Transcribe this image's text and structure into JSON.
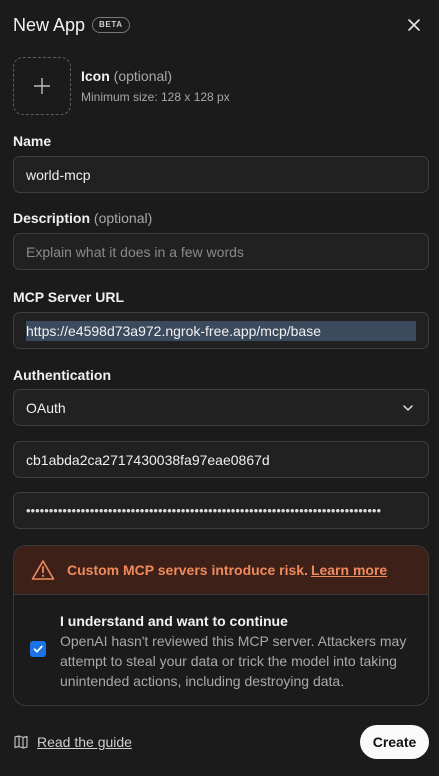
{
  "header": {
    "title": "New App",
    "badge": "BETA"
  },
  "icon": {
    "label": "Icon",
    "optional": "(optional)",
    "hint": "Minimum size: 128 x 128 px"
  },
  "name": {
    "label": "Name",
    "value": "world-mcp"
  },
  "description": {
    "label": "Description",
    "optional": "(optional)",
    "placeholder": "Explain what it does in a few words"
  },
  "mcp_url": {
    "label": "MCP Server URL",
    "value": "https://e4598d73a972.ngrok-free.app/mcp/base"
  },
  "authentication": {
    "label": "Authentication",
    "selected": "OAuth",
    "client_id": "cb1abda2ca2717430038fa97eae0867d",
    "client_secret_masked": "••••••••••••••••••••••••••••••••••••••••••••••••••••••••••••••••••••••••••••••"
  },
  "warning": {
    "text": "Custom MCP servers introduce risk.",
    "link": "Learn more",
    "accent": "#f08a5d",
    "confirm_title": "I understand and want to continue",
    "confirm_body": "OpenAI hasn't reviewed this MCP server. Attackers may attempt to steal your data or trick the model into taking unintended actions, including destroying data.",
    "checked": true
  },
  "footer": {
    "guide": "Read the guide",
    "create": "Create"
  }
}
